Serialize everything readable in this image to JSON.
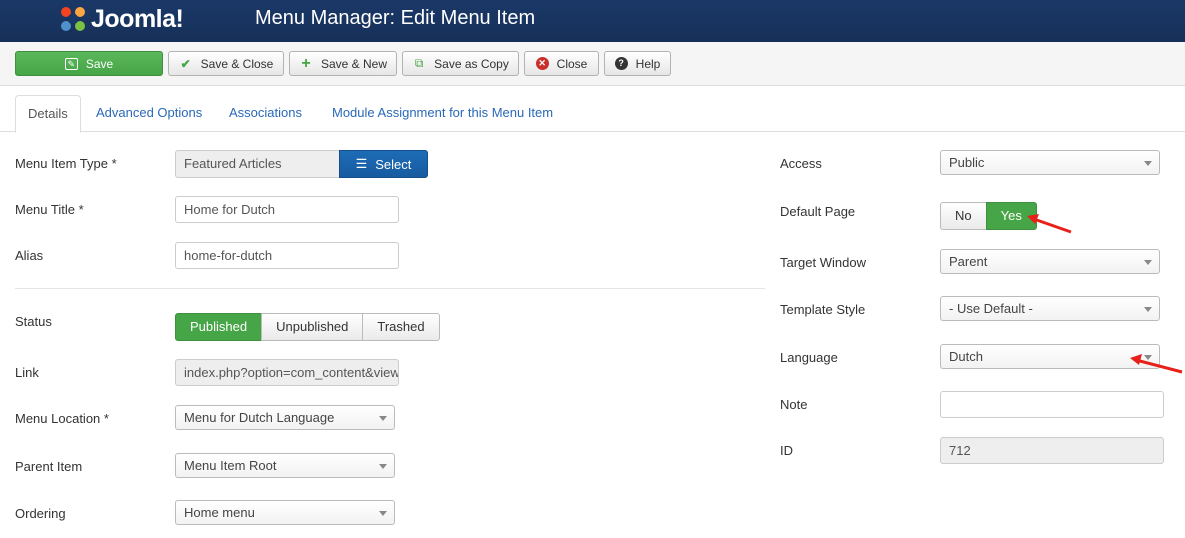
{
  "header": {
    "logo_text": "Joomla!",
    "title": "Menu Manager: Edit Menu Item"
  },
  "toolbar": {
    "save": "Save",
    "save_close": "Save & Close",
    "save_new": "Save & New",
    "save_copy": "Save as Copy",
    "close": "Close",
    "help": "Help"
  },
  "tabs": [
    "Details",
    "Advanced Options",
    "Associations",
    "Module Assignment for this Menu Item"
  ],
  "left": {
    "menu_item_type": {
      "label": "Menu Item Type *",
      "value": "Featured Articles",
      "button": "Select"
    },
    "menu_title": {
      "label": "Menu Title *",
      "value": "Home for Dutch"
    },
    "alias": {
      "label": "Alias",
      "value": "home-for-dutch"
    },
    "status": {
      "label": "Status",
      "options": [
        "Published",
        "Unpublished",
        "Trashed"
      ],
      "selected": "Published"
    },
    "link": {
      "label": "Link",
      "value": "index.php?option=com_content&view=featured"
    },
    "menu_location": {
      "label": "Menu Location *",
      "value": "Menu for Dutch Language"
    },
    "parent_item": {
      "label": "Parent Item",
      "value": "Menu Item Root"
    },
    "ordering": {
      "label": "Ordering",
      "value": "Home menu"
    }
  },
  "right": {
    "access": {
      "label": "Access",
      "value": "Public"
    },
    "default_page": {
      "label": "Default Page",
      "options": [
        "No",
        "Yes"
      ],
      "selected": "Yes"
    },
    "target_window": {
      "label": "Target Window",
      "value": "Parent"
    },
    "template_style": {
      "label": "Template Style",
      "value": "- Use Default -"
    },
    "language": {
      "label": "Language",
      "value": "Dutch"
    },
    "note": {
      "label": "Note",
      "value": ""
    },
    "id": {
      "label": "ID",
      "value": "712"
    }
  },
  "colors": {
    "header_bg": "#1a3867",
    "success": "#46a546",
    "primary": "#1d6cb6",
    "link": "#2a69b8",
    "annotation_arrow": "#e8201a"
  }
}
